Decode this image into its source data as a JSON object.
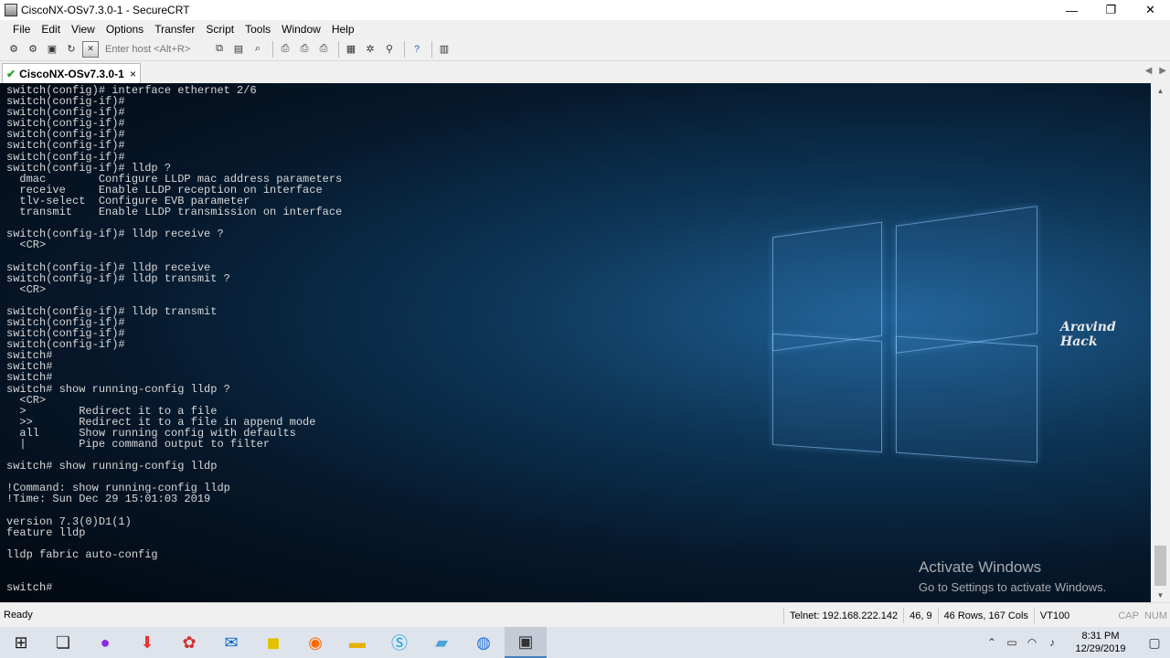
{
  "window": {
    "title": "CiscoNX-OSv7.3.0-1 - SecureCRT",
    "minimize": "—",
    "maximize": "❐",
    "close": "✕"
  },
  "menu": [
    "File",
    "Edit",
    "View",
    "Options",
    "Transfer",
    "Script",
    "Tools",
    "Window",
    "Help"
  ],
  "toolbar": {
    "host_placeholder": "Enter host <Alt+R>"
  },
  "tab": {
    "label": "CiscoNX-OSv7.3.0-1",
    "close": "×"
  },
  "terminal": {
    "lines": [
      "switch(config)# interface ethernet 2/6",
      "switch(config-if)#",
      "switch(config-if)#",
      "switch(config-if)#",
      "switch(config-if)#",
      "switch(config-if)#",
      "switch(config-if)#",
      "switch(config-if)# lldp ?",
      "  dmac        Configure LLDP mac address parameters",
      "  receive     Enable LLDP reception on interface",
      "  tlv-select  Configure EVB parameter",
      "  transmit    Enable LLDP transmission on interface",
      "",
      "switch(config-if)# lldp receive ?",
      "  <CR>",
      "",
      "switch(config-if)# lldp receive",
      "switch(config-if)# lldp transmit ?",
      "  <CR>",
      "",
      "switch(config-if)# lldp transmit",
      "switch(config-if)#",
      "switch(config-if)#",
      "switch(config-if)#",
      "switch#",
      "switch#",
      "switch#",
      "switch# show running-config lldp ?",
      "  <CR>",
      "  >        Redirect it to a file",
      "  >>       Redirect it to a file in append mode",
      "  all      Show running config with defaults",
      "  |        Pipe command output to filter",
      "",
      "switch# show running-config lldp",
      "",
      "!Command: show running-config lldp",
      "!Time: Sun Dec 29 15:01:03 2019",
      "",
      "version 7.3(0)D1(1)",
      "feature lldp",
      "",
      "lldp fabric auto-config",
      "",
      "",
      "switch#"
    ]
  },
  "watermark": "Aravind Hack",
  "activation": {
    "title": "Activate Windows",
    "subtitle": "Go to Settings to activate Windows."
  },
  "status": {
    "ready": "Ready",
    "connection": "Telnet: 192.168.222.142",
    "cursor": "46,  9",
    "size": "46 Rows, 167 Cols",
    "emulation": "VT100",
    "caps": "CAP",
    "num": "NUM"
  },
  "taskbar": {
    "time": "8:31 PM",
    "date": "12/29/2019"
  }
}
